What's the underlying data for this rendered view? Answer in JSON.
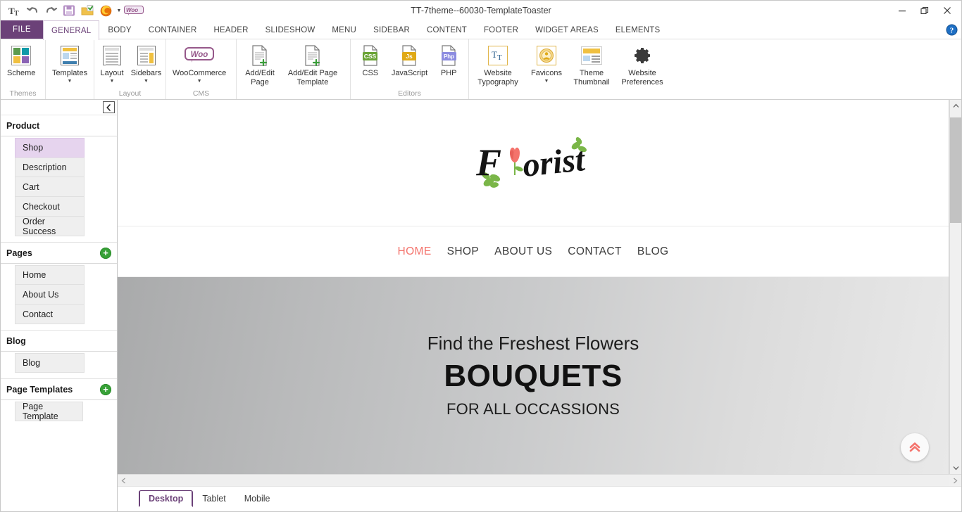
{
  "window": {
    "title": "TT-7theme--60030-TemplateToaster",
    "controls": {
      "minimize": "—",
      "restore": "❐",
      "close": "✕"
    },
    "help_icon": "question-mark-icon"
  },
  "quick_access": {
    "items": [
      {
        "name": "typography-icon",
        "label": "Tₜ"
      },
      {
        "name": "undo-icon",
        "label": "↶"
      },
      {
        "name": "redo-icon",
        "label": "↷"
      },
      {
        "name": "save-icon",
        "label": "save"
      },
      {
        "name": "export-icon",
        "label": "export"
      },
      {
        "name": "firefox-preview-icon",
        "label": "preview"
      },
      {
        "name": "woocommerce-icon",
        "label": "Woo"
      }
    ]
  },
  "ribbon": {
    "file_tab": "FILE",
    "tabs": [
      "GENERAL",
      "BODY",
      "CONTAINER",
      "HEADER",
      "SLIDESHOW",
      "MENU",
      "SIDEBAR",
      "CONTENT",
      "FOOTER",
      "WIDGET AREAS",
      "ELEMENTS"
    ],
    "active_tab": "GENERAL",
    "groups": [
      {
        "label": "Themes",
        "items": [
          {
            "name": "scheme-button",
            "label": "Scheme",
            "icon": "color-scheme-icon",
            "dropdown": false
          }
        ]
      },
      {
        "label": "",
        "items": [
          {
            "name": "templates-button",
            "label": "Templates",
            "icon": "templates-icon",
            "dropdown": true
          }
        ]
      },
      {
        "label": "Layout",
        "items": [
          {
            "name": "layout-button",
            "label": "Layout",
            "icon": "layout-icon",
            "dropdown": true
          },
          {
            "name": "sidebars-button",
            "label": "Sidebars",
            "icon": "sidebars-icon",
            "dropdown": true
          }
        ]
      },
      {
        "label": "CMS",
        "items": [
          {
            "name": "woocommerce-button",
            "label": "WooCommerce",
            "icon": "woo-icon",
            "dropdown": true
          }
        ]
      },
      {
        "label": "",
        "items": [
          {
            "name": "add-edit-page-button",
            "label": "Add/Edit\nPage",
            "icon": "add-page-icon",
            "dropdown": false
          },
          {
            "name": "add-edit-page-template-button",
            "label": "Add/Edit Page\nTemplate",
            "icon": "add-page-template-icon",
            "dropdown": false
          }
        ]
      },
      {
        "label": "Editors",
        "items": [
          {
            "name": "css-editor-button",
            "label": "CSS",
            "icon": "css-file-icon",
            "badge": "CSS",
            "badge_color": "#6aa335",
            "dropdown": false
          },
          {
            "name": "javascript-editor-button",
            "label": "JavaScript",
            "icon": "js-file-icon",
            "badge": "Js",
            "badge_color": "#e0a916",
            "dropdown": false
          },
          {
            "name": "php-editor-button",
            "label": "PHP",
            "icon": "php-file-icon",
            "badge": "Php",
            "badge_color": "#8c8ce0",
            "dropdown": false
          }
        ]
      },
      {
        "label": "",
        "items": [
          {
            "name": "website-typography-button",
            "label": "Website\nTypography",
            "icon": "typography-icon",
            "dropdown": false
          },
          {
            "name": "favicons-button",
            "label": "Favicons",
            "icon": "favicon-icon",
            "dropdown": true
          },
          {
            "name": "theme-thumbnail-button",
            "label": "Theme\nThumbnail",
            "icon": "thumbnail-icon",
            "dropdown": false
          },
          {
            "name": "website-preferences-button",
            "label": "Website\nPreferences",
            "icon": "gear-icon",
            "dropdown": false
          }
        ]
      }
    ]
  },
  "left_panel": {
    "collapse_icon": "chevron-left-icon",
    "sections": [
      {
        "title": "Product",
        "has_add": false,
        "items": [
          "Shop",
          "Description",
          "Cart",
          "Checkout",
          "Order Success"
        ],
        "selected": "Shop"
      },
      {
        "title": "Pages",
        "has_add": true,
        "add_icon": "plus-circle-icon",
        "items": [
          "Home",
          "About Us",
          "Contact"
        ],
        "selected": null
      },
      {
        "title": "Blog",
        "has_add": false,
        "items": [
          "Blog"
        ],
        "selected": null
      },
      {
        "title": "Page Templates",
        "has_add": true,
        "add_icon": "plus-circle-icon",
        "items": [
          "Page Template"
        ],
        "selected": null
      }
    ]
  },
  "preview": {
    "logo": {
      "text": "Florist",
      "flower_color": "#f4736c",
      "leaf_color": "#7ab648",
      "text_color": "#1a1a1a"
    },
    "nav": {
      "links": [
        "HOME",
        "SHOP",
        "ABOUT US",
        "CONTACT",
        "BLOG"
      ],
      "active": "HOME",
      "active_color": "#f4736c",
      "link_color": "#3c3c3c"
    },
    "hero": {
      "subtitle_top": "Find the Freshest Flowers",
      "title": "BOUQUETS",
      "subtitle_bottom": "FOR ALL OCCASSIONS",
      "gradient_from": "#a9aaab",
      "gradient_to": "#e9e9e9"
    },
    "scroll_top_button": {
      "name": "scroll-to-top-button",
      "icon": "double-chevron-up-icon",
      "color": "#f4736c"
    }
  },
  "device_tabs": {
    "tabs": [
      "Desktop",
      "Tablet",
      "Mobile"
    ],
    "active": "Desktop",
    "active_color": "#6b4178"
  },
  "scrollbars": {
    "vertical": {
      "up_icon": "chevron-up-icon",
      "down_icon": "chevron-down-icon"
    },
    "horizontal": {
      "left_icon": "chevron-left-icon",
      "right_icon": "chevron-right-icon"
    }
  }
}
